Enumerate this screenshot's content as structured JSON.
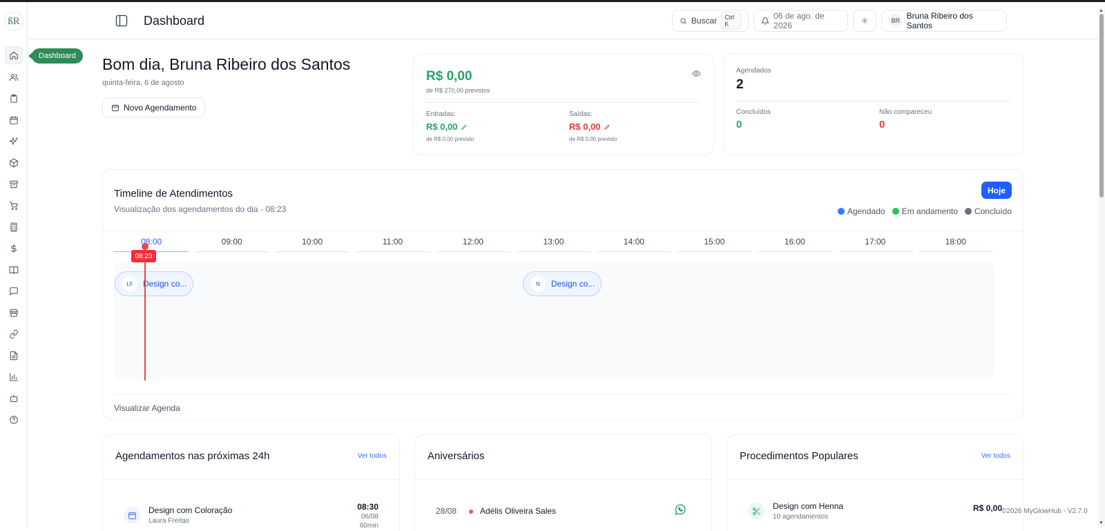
{
  "app": {
    "logo_text": "ßR",
    "tooltip": "Dashboard"
  },
  "sidebar": {
    "items": [
      {
        "name": "home-icon"
      },
      {
        "name": "users-icon"
      },
      {
        "name": "clipboard-icon"
      },
      {
        "name": "calendar-icon"
      },
      {
        "name": "sparkles-icon"
      },
      {
        "name": "package-icon"
      },
      {
        "name": "archive-icon"
      },
      {
        "name": "cart-icon"
      },
      {
        "name": "calculator-icon"
      },
      {
        "name": "dollar-icon"
      },
      {
        "name": "book-icon"
      },
      {
        "name": "message-icon"
      },
      {
        "name": "store-icon"
      },
      {
        "name": "link-icon"
      },
      {
        "name": "document-icon"
      },
      {
        "name": "bar-chart-icon"
      },
      {
        "name": "bot-icon"
      },
      {
        "name": "help-icon"
      }
    ]
  },
  "header": {
    "title": "Dashboard",
    "search_label": "Buscar",
    "search_shortcut": "Ctrl K",
    "date": "06 de ago. de 2026",
    "user_initials": "BR",
    "user_name": "Bruna Ribeiro dos Santos"
  },
  "welcome": {
    "greeting": "Bom dia, Bruna Ribeiro dos Santos",
    "date": "quinta-feira, 6 de agosto",
    "new_button": "Novo Agendamento"
  },
  "finance": {
    "total": "R$ 0,00",
    "total_sub": "de R$ 270,00 previstos",
    "income_label": "Entradas:",
    "income_value": "R$ 0,00",
    "income_sub": "de R$ 0.00 previsto",
    "expense_label": "Saídas:",
    "expense_value": "R$ 0,00",
    "expense_sub": "de R$ 0.00 previsto"
  },
  "stats": {
    "scheduled_label": "Agendados",
    "scheduled_value": "2",
    "done_label": "Concluídos",
    "done_value": "0",
    "noshow_label": "Não compareceu",
    "noshow_value": "0"
  },
  "timeline": {
    "title": "Timeline de Atendimentos",
    "subtitle": "Visualização dos agendamentos do dia - 08:23",
    "today_button": "Hoje",
    "legend": [
      {
        "label": "Agendado",
        "color": "#2f7cf6"
      },
      {
        "label": "Em andamento",
        "color": "#22c55e"
      },
      {
        "label": "Concluído",
        "color": "#6b7280"
      }
    ],
    "hours": [
      "08:00",
      "09:00",
      "10:00",
      "11:00",
      "12:00",
      "13:00",
      "14:00",
      "15:00",
      "16:00",
      "17:00",
      "18:00"
    ],
    "now_label": "08:23",
    "appointments": [
      {
        "initials": "LF",
        "label": "Design co..."
      },
      {
        "initials": "N",
        "label": "Design co..."
      }
    ],
    "footer_link": "Visualizar Agenda"
  },
  "upcoming": {
    "title": "Agendamentos nas próximas 24h",
    "see_all": "Ver todos",
    "items": [
      {
        "service": "Design com Coloração",
        "client": "Laura Freitas",
        "time": "08:30",
        "date": "06/08",
        "duration": "60min"
      }
    ]
  },
  "birthdays": {
    "title": "Aniversários",
    "items": [
      {
        "date": "28/08",
        "name": "Adélis Oliveira Sales"
      }
    ]
  },
  "popular": {
    "title": "Procedimentos Populares",
    "see_all": "Ver todos",
    "items": [
      {
        "name": "Design com Henna",
        "count": "10 agendamentos",
        "price": "R$ 0,00"
      }
    ]
  },
  "footer": {
    "copyright": "©2026 MyGlowHub - V2.7.0"
  },
  "colors": {
    "accent": "#1f5eff",
    "brand_green": "#2e8b57",
    "positive": "#22a36a",
    "negative": "#e23b3b",
    "now_line": "#ef4444"
  }
}
